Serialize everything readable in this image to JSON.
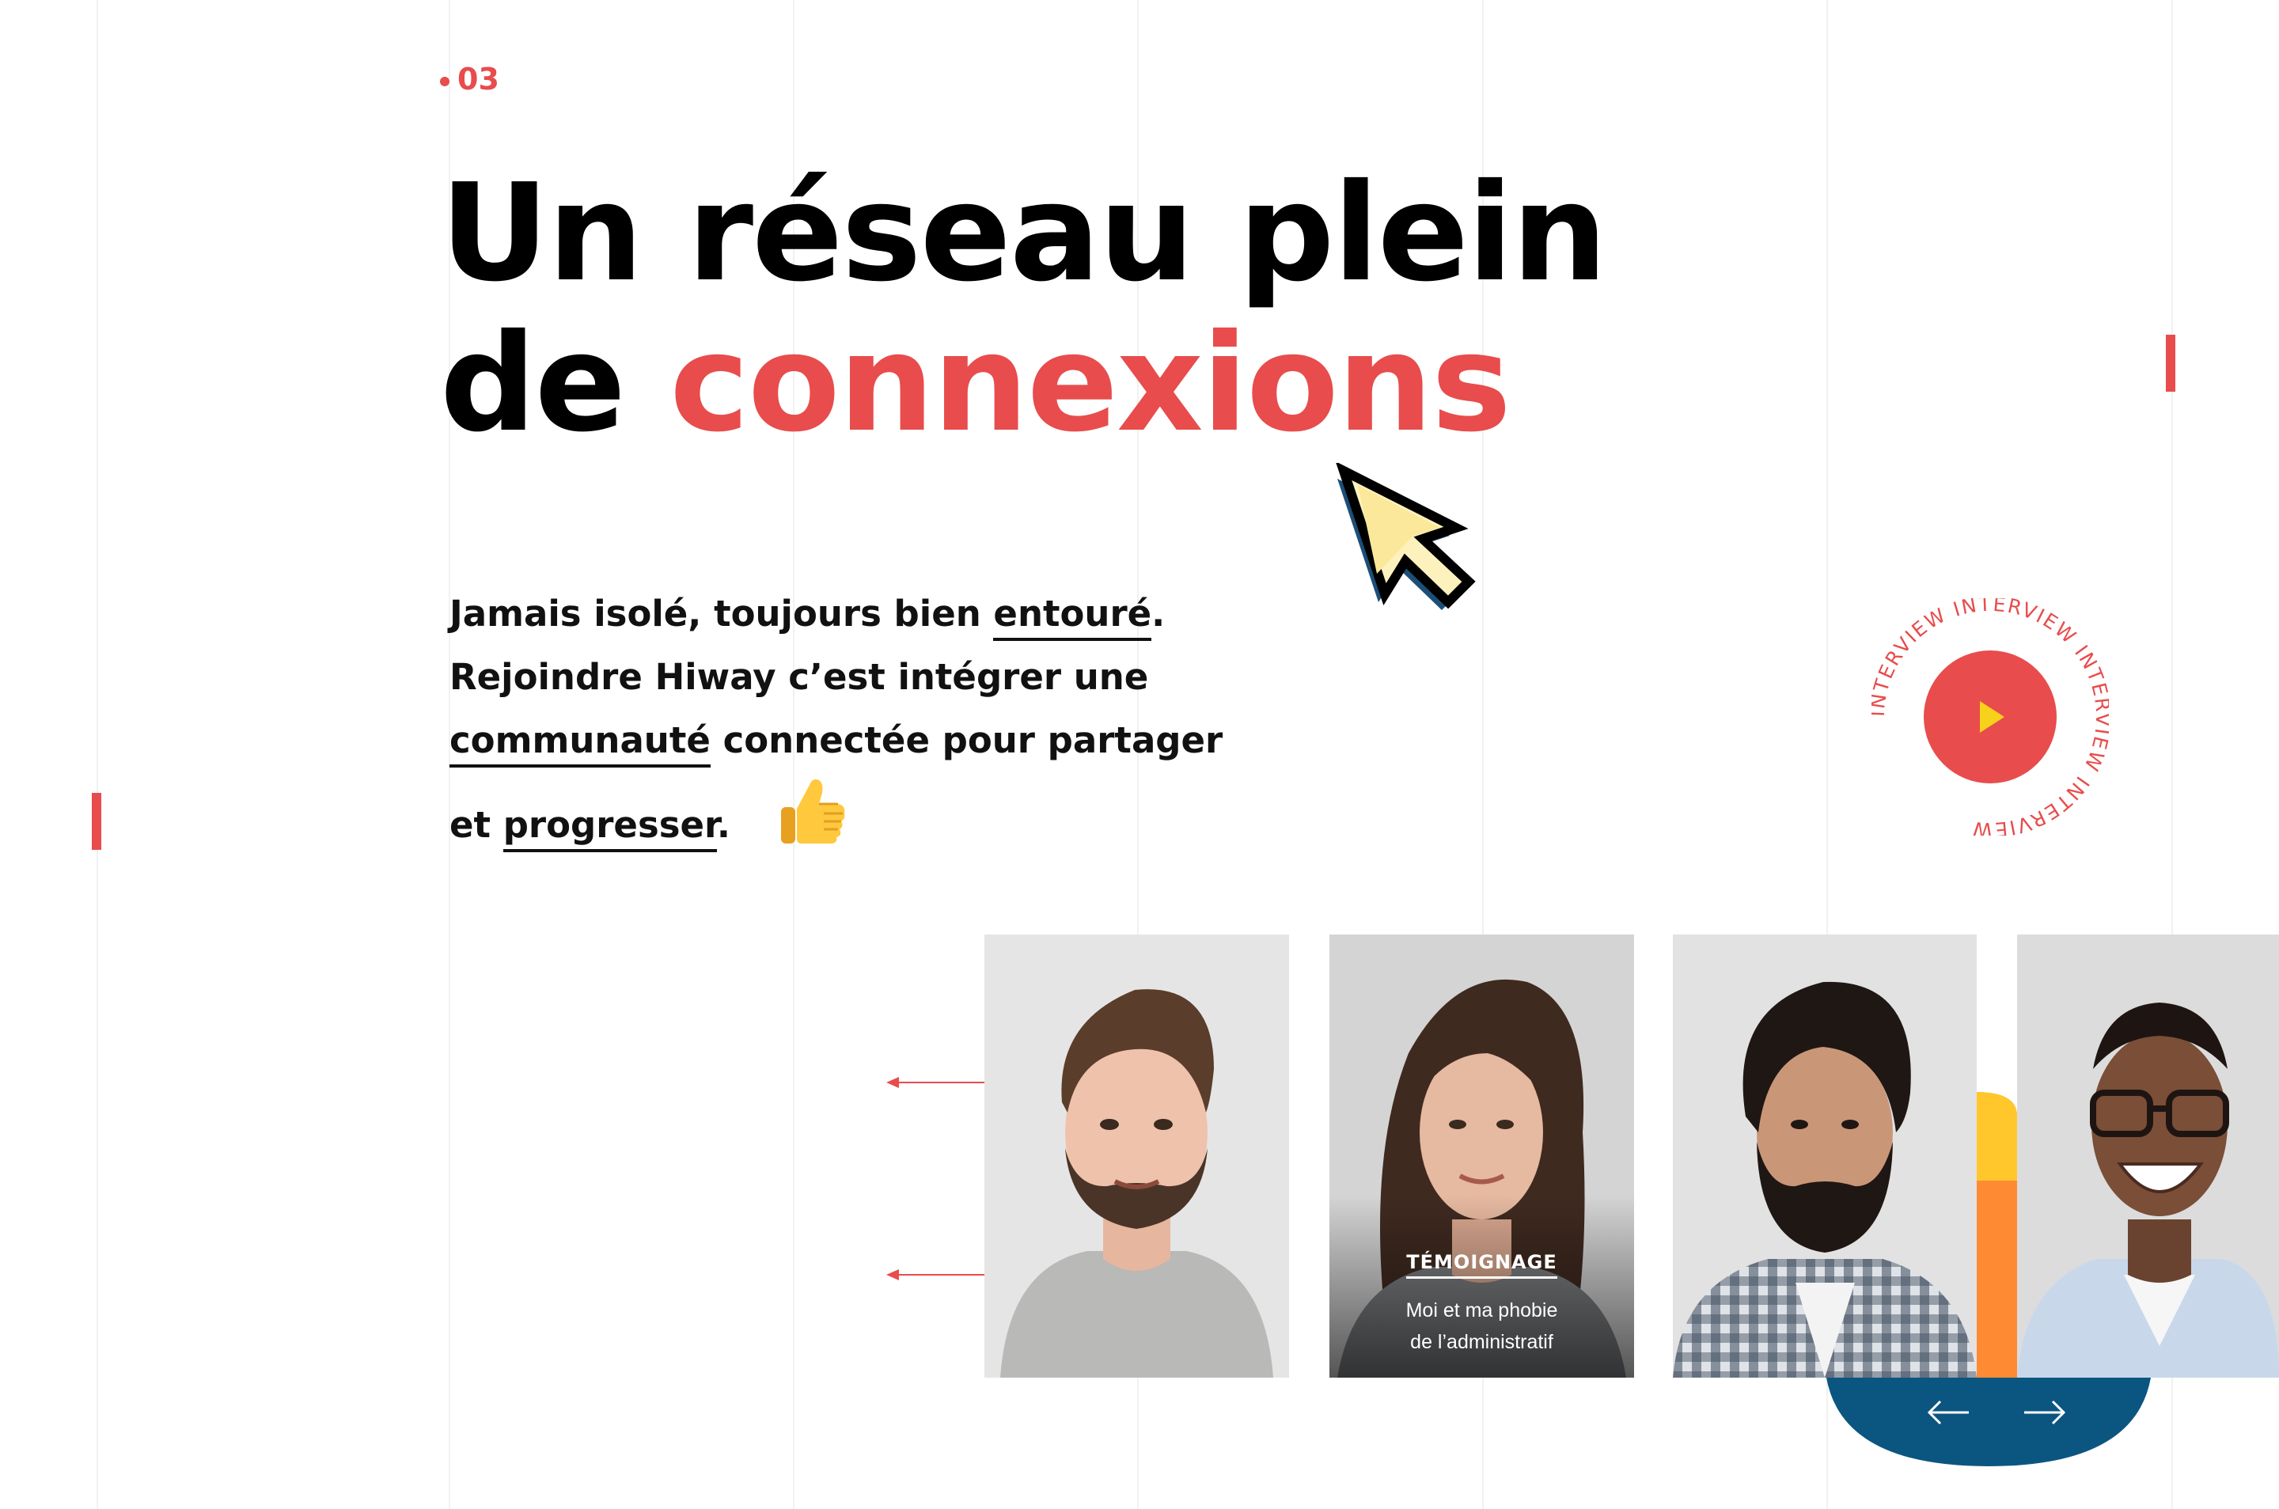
{
  "section": {
    "number": "03"
  },
  "headline": {
    "line1": "Un réseau plein",
    "line2_prefix": "de",
    "line2_highlight": "connexions"
  },
  "intro": {
    "part1": "Jamais isolé, toujours bien",
    "word_entoure": "entouré",
    "dot1": ".",
    "part2": "Rejoindre Hiway c’est intégrer une",
    "word_communaute": "communauté",
    "part3": "connectée pour partager",
    "part4": "et",
    "word_progresser": "progresser",
    "dot2": "."
  },
  "interview_badge": {
    "ring_text": "INTERVIEW INTERVIEW INTERVIEW INTERVIEW"
  },
  "cards": [
    {
      "name": "profile-card-1"
    },
    {
      "name": "profile-card-2",
      "tag": "TÉMOIGNAGE",
      "line1": "Moi et ma phobie",
      "line2": "de l’administratif"
    },
    {
      "name": "profile-card-3"
    },
    {
      "name": "profile-card-4"
    }
  ],
  "icons": {
    "cursor": "pixel-cursor-icon",
    "thumb": "thumbs-up-icon",
    "play": "play-icon",
    "prev": "arrow-left-icon",
    "next": "arrow-right-icon"
  },
  "colors": {
    "accent": "#e84c4c",
    "dark_blue": "#0b5680",
    "yellow": "#ffc72c",
    "orange": "#ff8a34",
    "play_triangle": "#f7d21b"
  }
}
